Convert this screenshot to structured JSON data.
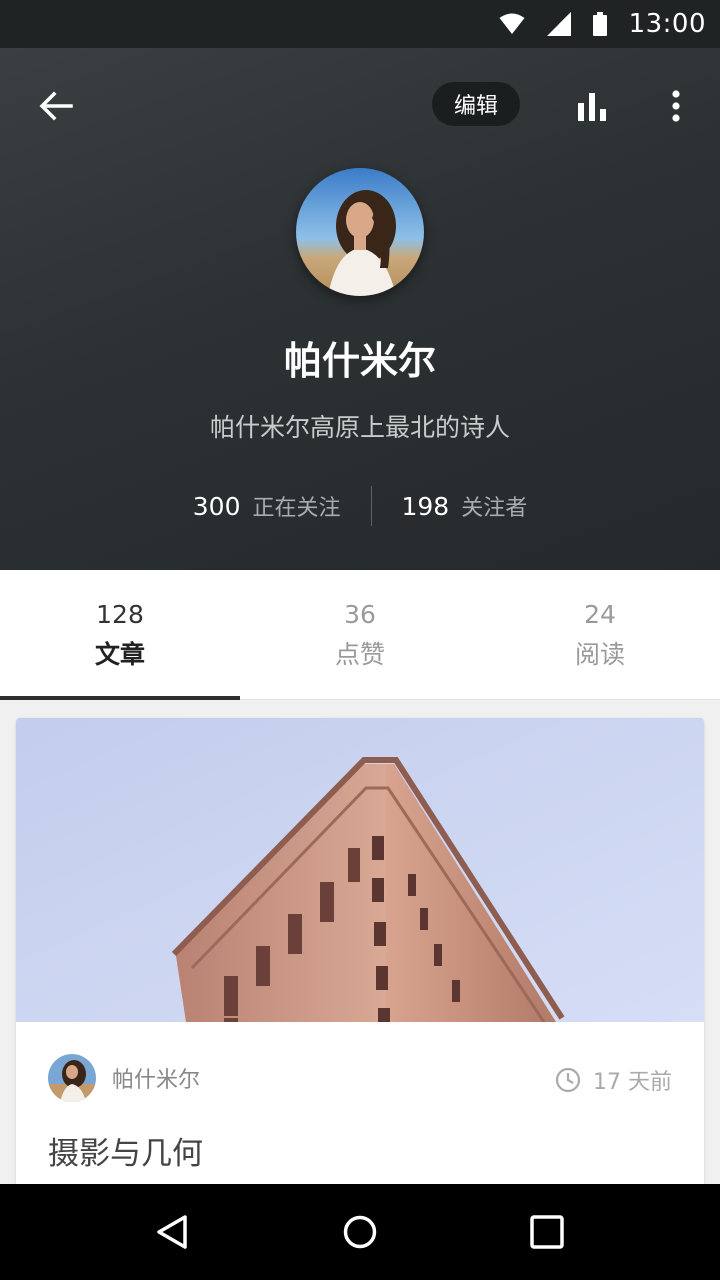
{
  "status_bar": {
    "time": "13:00",
    "icons": [
      "wifi-icon",
      "signal-icon",
      "battery-icon"
    ]
  },
  "header": {
    "edit_label": "编辑",
    "name": "帕什米尔",
    "bio": "帕什米尔高原上最北的诗人",
    "following_count": "300",
    "following_label": "正在关注",
    "followers_count": "198",
    "followers_label": "关注者"
  },
  "tabs": [
    {
      "count": "128",
      "label": "文章",
      "active": true
    },
    {
      "count": "36",
      "label": "点赞",
      "active": false
    },
    {
      "count": "24",
      "label": "阅读",
      "active": false
    }
  ],
  "card": {
    "author": "帕什米尔",
    "time": "17 天前",
    "title": "摄影与几何"
  },
  "colors": {
    "header_bg": "#2c3133",
    "status_bar": "#1f2324",
    "accent_indicator": "#2b2f31"
  }
}
